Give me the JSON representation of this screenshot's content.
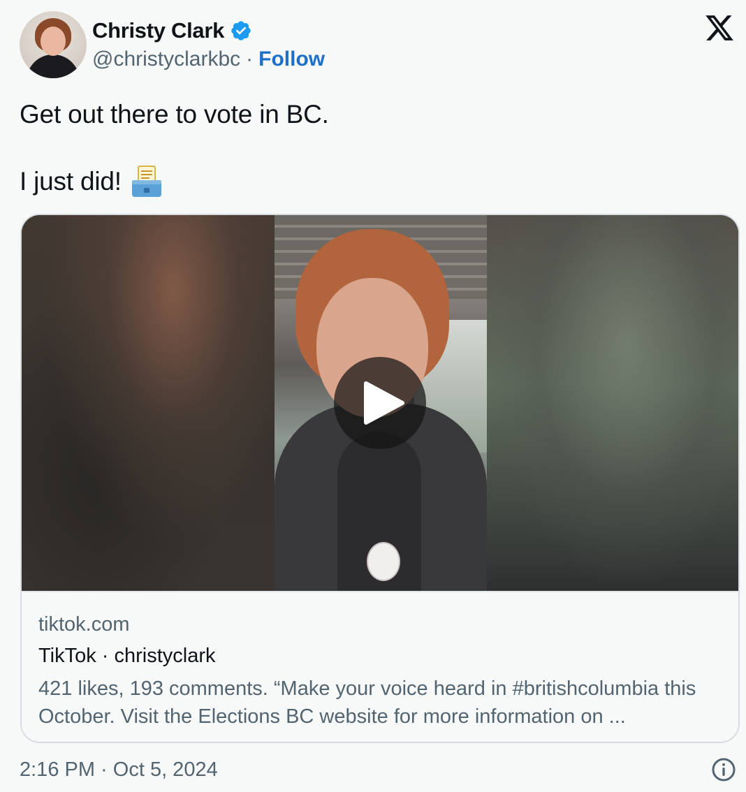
{
  "author": {
    "name": "Christy Clark",
    "handle": "@christyclarkbc",
    "separator": "·",
    "follow_label": "Follow"
  },
  "tweet": {
    "line1": "Get out there to vote in BC.",
    "line2": "I just did!"
  },
  "card": {
    "domain": "tiktok.com",
    "title": "TikTok · christyclark",
    "description": "421 likes, 193 comments. “Make your voice heard in #britishcolumbia this October. Visit the Elections BC website for more information on ..."
  },
  "footer": {
    "timestamp": "2:16 PM · Oct 5, 2024"
  },
  "icons": {
    "verified": "verified-badge-icon",
    "x_logo": "x-logo-icon",
    "ballot": "ballot-box-emoji-icon",
    "play": "play-icon",
    "info": "info-icon"
  },
  "colors": {
    "follow": "#1d70c9",
    "verified": "#1d9bf0",
    "secondary_text": "#536471"
  }
}
